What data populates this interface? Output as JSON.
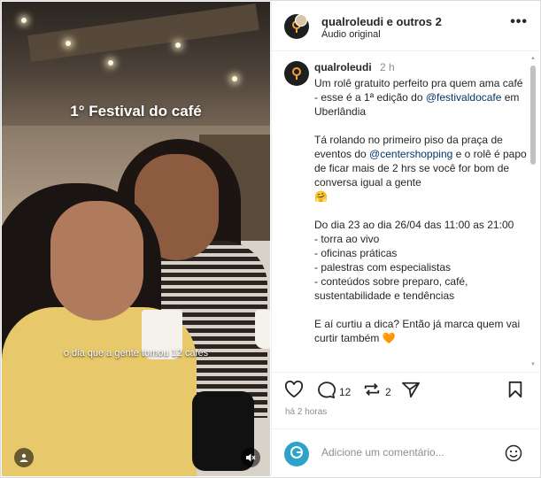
{
  "media": {
    "overlay_title": "1° Festival do café",
    "caption": "o dia que a gente tomou 12 cafés",
    "icons": [
      "user-tag-icon",
      "speaker-muted-icon"
    ]
  },
  "header": {
    "title": "qualroleudi e outros 2",
    "audio": "Áudio original",
    "more": "•••"
  },
  "comment": {
    "author": "qualroleudi",
    "time": "2 h",
    "p1_a": "Um rolê gratuito perfeito pra quem ama café - esse é a 1ª edição do ",
    "p1_link": "@festivaldocafe",
    "p1_b": " em Uberlândia",
    "p2_a": "Tá rolando no primeiro piso da praça de eventos do ",
    "p2_link": "@centershopping",
    "p2_b": " e o rolê é papo de ficar mais de 2 hrs se você for bom de conversa igual a gente",
    "emoji1": "🤗",
    "p3": "Do dia 23 ao dia 26/04 das 11:00 as 21:00\n- torra ao vivo\n- oficinas práticas\n- palestras com especialistas\n- conteúdos sobre preparo, café, sustentabilidade e tendências",
    "p4": "E aí curtiu a dica? Então já marca quem vai curtir também",
    "emoji2": "🧡"
  },
  "actions": {
    "comments_count": "12",
    "reposts_count": "2"
  },
  "date": "há 2 horas",
  "add_comment": {
    "placeholder": "Adicione um comentário..."
  },
  "colors": {
    "link": "#00376b",
    "muted": "#8e8e8e",
    "border": "#dbdbdb"
  }
}
